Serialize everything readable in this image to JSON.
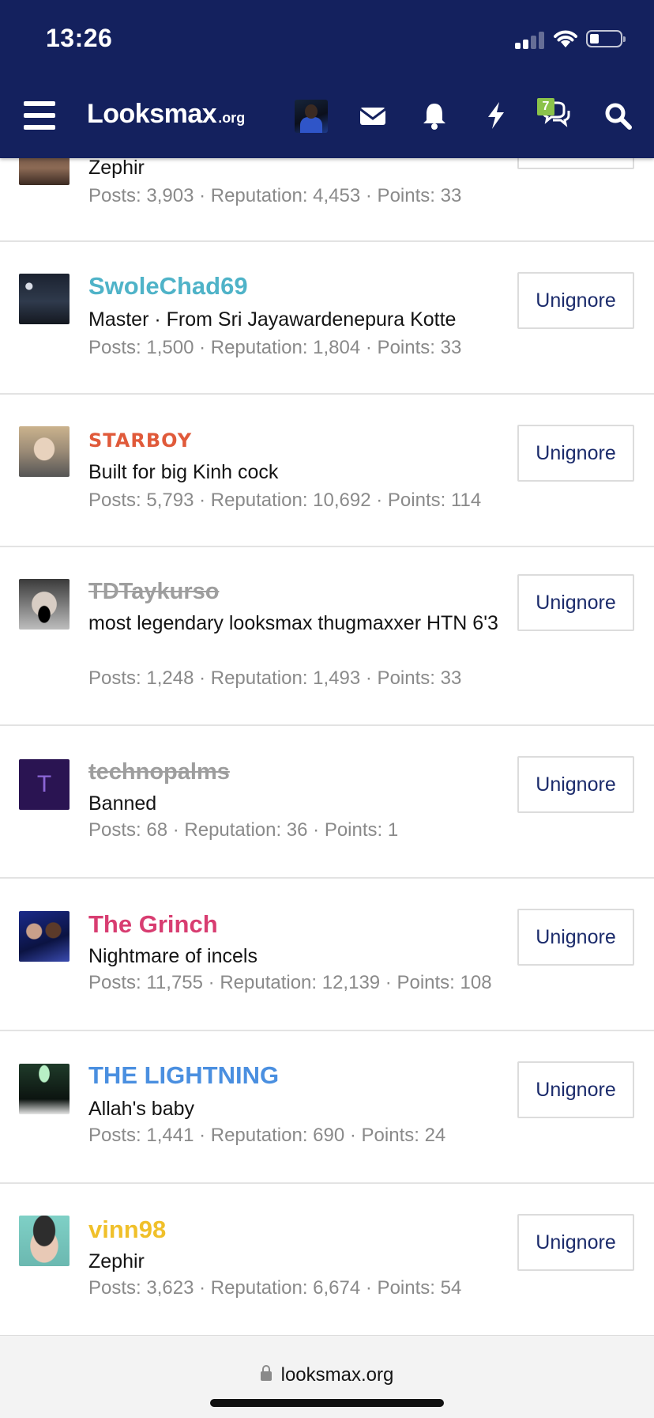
{
  "status_bar": {
    "time": "13:26",
    "icons": [
      "cellular-signal-icon",
      "wifi-icon",
      "battery-icon"
    ]
  },
  "header": {
    "logo_main": "Looksmax",
    "logo_tld": ".org",
    "nav_icons": [
      "menu-icon",
      "avatar",
      "envelope-icon",
      "bell-icon",
      "lightning-icon",
      "conversations-icon",
      "search-icon"
    ],
    "conversations_badge": "7",
    "brand_color": "#14215e"
  },
  "ignored_users": [
    {
      "name": "",
      "title": "Zephir",
      "stats": "Posts: 3,903 · Reputation: 4,453 · Points: 33",
      "button": "Unignore"
    },
    {
      "name": "SwoleChad69",
      "title": "Master · From Sri Jayawardenepura Kotte",
      "stats": "Posts: 1,500 · Reputation: 1,804 · Points: 33",
      "button": "Unignore"
    },
    {
      "name": "STARBOY",
      "title": "Built for big Kinh cock",
      "stats": "Posts: 5,793 · Reputation: 10,692 · Points: 114",
      "button": "Unignore"
    },
    {
      "name": "TDTaykurso",
      "title": "most legendary looksmax thugmaxxer HTN 6'3",
      "stats": "Posts: 1,248 · Reputation: 1,493 · Points: 33",
      "button": "Unignore"
    },
    {
      "name": "technopalms",
      "avatar_letter": "T",
      "title": "Banned",
      "stats": "Posts: 68 · Reputation: 36 · Points: 1",
      "button": "Unignore"
    },
    {
      "name": "The Grinch",
      "title": "Nightmare of incels",
      "stats": "Posts: 11,755 · Reputation: 12,139 · Points: 108",
      "button": "Unignore"
    },
    {
      "name": "THE LIGHTNING",
      "title": "Allah's baby",
      "stats": "Posts: 1,441 · Reputation: 690 · Points: 24",
      "button": "Unignore"
    },
    {
      "name": "vinn98",
      "title": "Zephir",
      "stats": "Posts: 3,623 · Reputation: 6,674 · Points: 54",
      "button": "Unignore"
    }
  ],
  "browser": {
    "url": "looksmax.org"
  }
}
